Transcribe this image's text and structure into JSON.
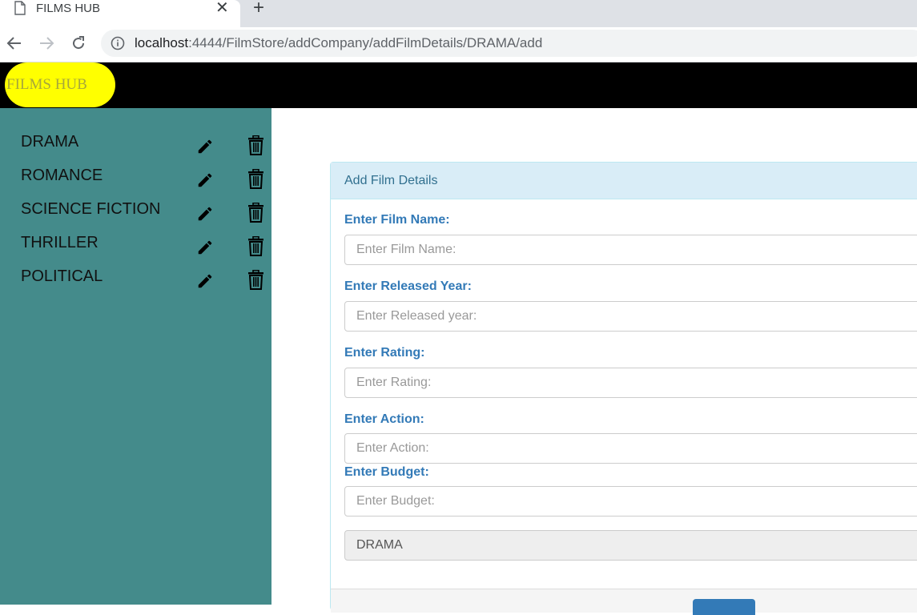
{
  "browser": {
    "tab_title": "FILMS HUB",
    "url_host": "localhost",
    "url_path": ":4444/FilmStore/addCompany/addFilmDetails/DRAMA/add"
  },
  "app": {
    "logo": "FILMS HUB"
  },
  "sidebar": {
    "items": [
      {
        "label": "DRAMA"
      },
      {
        "label": "ROMANCE"
      },
      {
        "label": "SCIENCE FICTION"
      },
      {
        "label": "THRILLER"
      },
      {
        "label": "POLITICAL"
      }
    ]
  },
  "form": {
    "heading": "Add Film Details",
    "film_name": {
      "label": "Enter Film Name:",
      "placeholder": "Enter Film Name:"
    },
    "released_year": {
      "label": "Enter Released Year:",
      "placeholder": "Enter Released year:"
    },
    "rating": {
      "label": "Enter Rating:",
      "placeholder": "Enter Rating:"
    },
    "action": {
      "label": "Enter Action:",
      "placeholder": "Enter Action:"
    },
    "budget": {
      "label": "Enter Budget:",
      "placeholder": "Enter Budget:"
    },
    "category_value": "DRAMA"
  },
  "colors": {
    "sidebar_bg": "#448b8b",
    "header_bg": "#000000",
    "logo_bg": "#ffff00",
    "panel_heading_bg": "#d9edf7",
    "label_color": "#337ab7"
  }
}
